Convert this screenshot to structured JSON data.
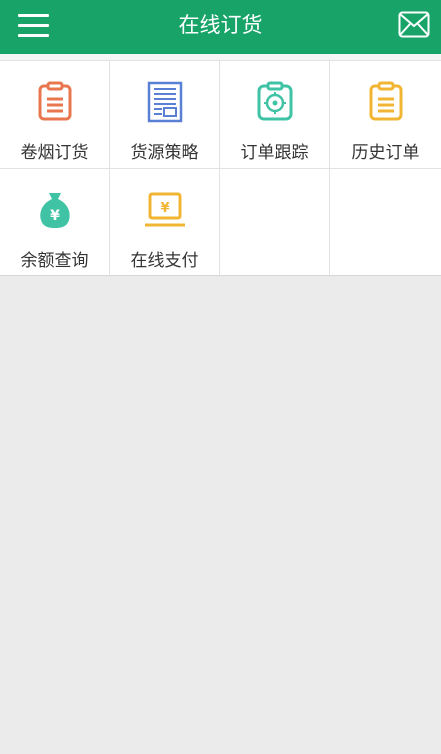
{
  "header": {
    "title": "在线订货",
    "menu_icon": "hamburger-menu-icon",
    "mail_icon": "mail-icon",
    "color": "#18a468"
  },
  "grid": {
    "items": [
      {
        "label": "卷烟订货",
        "icon": "clipboard-icon",
        "color": "#e8774f"
      },
      {
        "label": "货源策略",
        "icon": "document-icon",
        "color": "#5a80d6"
      },
      {
        "label": "订单跟踪",
        "icon": "target-icon",
        "color": "#3fc3a4"
      },
      {
        "label": "历史订单",
        "icon": "clipboard-icon",
        "color": "#f2b533"
      },
      {
        "label": "余额查询",
        "icon": "money-bag-icon",
        "color": "#3fc3a4"
      },
      {
        "label": "在线支付",
        "icon": "laptop-payment-icon",
        "color": "#f2b533"
      }
    ]
  }
}
